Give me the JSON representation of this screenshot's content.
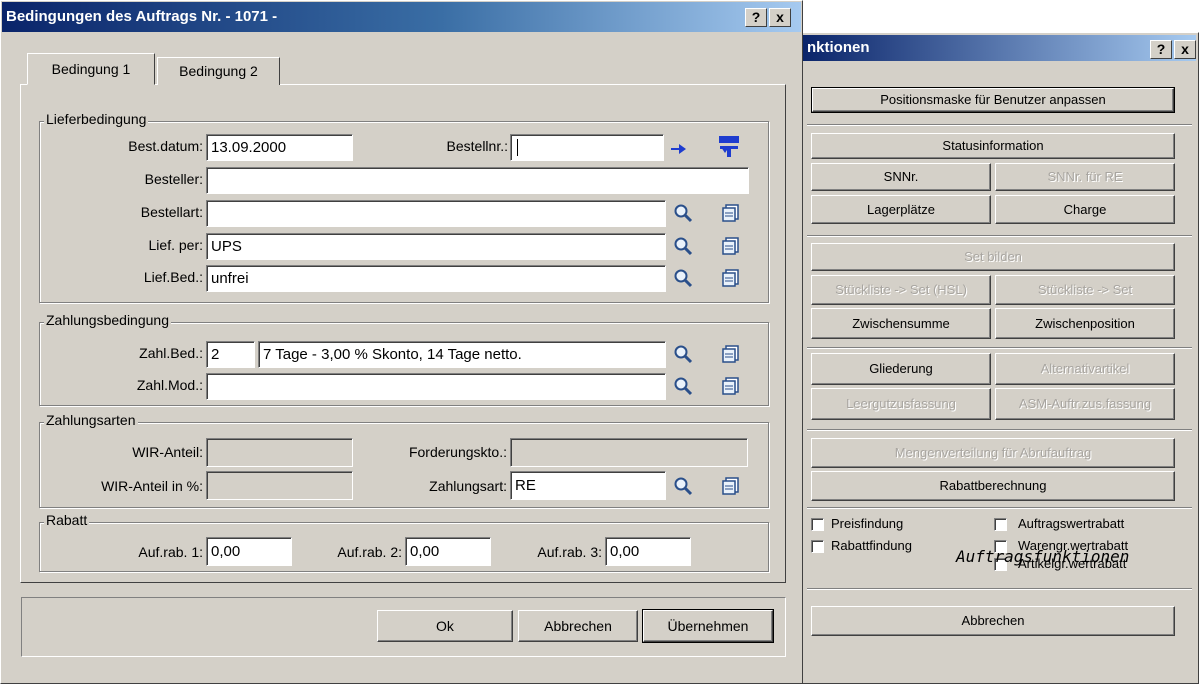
{
  "functions_dialog": {
    "title": "nktionen",
    "help_btn": "?",
    "close_btn": "x",
    "btn_customize": "Positionsmaske für Benutzer anpassen",
    "btn_status": "Statusinformation",
    "btn_snnr": "SNNr.",
    "btn_snnr_re": "SNNr. für RE",
    "btn_storage": "Lagerplätze",
    "btn_charge": "Charge",
    "btn_set": "Set bilden",
    "btn_bom_set_hsl": "Stückliste -> Set (HSL)",
    "btn_bom_set": "Stückliste -> Set",
    "btn_subtotal": "Zwischensumme",
    "btn_interpos": "Zwischenposition",
    "btn_structure": "Gliederung",
    "btn_alt": "Alternativartikel",
    "btn_empties": "Leergutzusfassung",
    "btn_asm": "ASM-Auftr.zus.fassung",
    "btn_distribution": "Mengenverteilung für Abrufauftrag",
    "btn_discount": "Rabattberechnung",
    "chk_pricing": "Preisfindung",
    "chk_discount_find": "Rabattfindung",
    "chk_order_discount": "Auftragswertrabatt",
    "chk_goods_discount": "Warengr.wertrabatt",
    "chk_article_discount": "Artikelgr.wertrabatt",
    "overlay_caption": "Auftragsfunktionen",
    "btn_cancel": "Abbrechen"
  },
  "conditions_dialog": {
    "title": "Bedingungen des Auftrags Nr. - 1071 -",
    "help_btn": "?",
    "close_btn": "x",
    "tabs": [
      "Bedingung 1",
      "Bedingung 2"
    ],
    "delivery": {
      "group": "Lieferbedingung",
      "order_date_label": "Best.datum:",
      "order_date": "13.09.2000",
      "order_no_label": "Bestellnr.:",
      "order_no": "",
      "orderer_label": "Besteller:",
      "orderer": "",
      "order_type_label": "Bestellart:",
      "order_type": "",
      "ship_via_label": "Lief. per:",
      "ship_via": "UPS",
      "delivery_terms_label": "Lief.Bed.:",
      "delivery_terms": "unfrei"
    },
    "payment": {
      "group": "Zahlungsbedingung",
      "terms_label": "Zahl.Bed.:",
      "terms_code": "2",
      "terms_text": "7 Tage - 3,00 % Skonto, 14 Tage netto.",
      "mode_label": "Zahl.Mod.:",
      "mode": ""
    },
    "payment_types": {
      "group": "Zahlungsarten",
      "wir_label": "WIR-Anteil:",
      "wir": "",
      "receivables_label": "Forderungskto.:",
      "receivables": "",
      "wir_pct_label": "WIR-Anteil in %:",
      "wir_pct": "",
      "payment_type_label": "Zahlungsart:",
      "payment_type": "RE"
    },
    "discount": {
      "group": "Rabatt",
      "d1_label": "Auf.rab. 1:",
      "d1": "0,00",
      "d2_label": "Auf.rab. 2:",
      "d2": "0,00",
      "d3_label": "Auf.rab. 3:",
      "d3": "0,00"
    },
    "ok": "Ok",
    "cancel": "Abbrechen",
    "apply": "Übernehmen"
  },
  "icons": [
    "arrow-icon",
    "next-order-icon",
    "search-icon",
    "list-icon"
  ],
  "colors": {
    "titlebar_start": "#0a246a",
    "titlebar_end": "#a6caf0",
    "dialog_bg": "#d4d0c8"
  }
}
